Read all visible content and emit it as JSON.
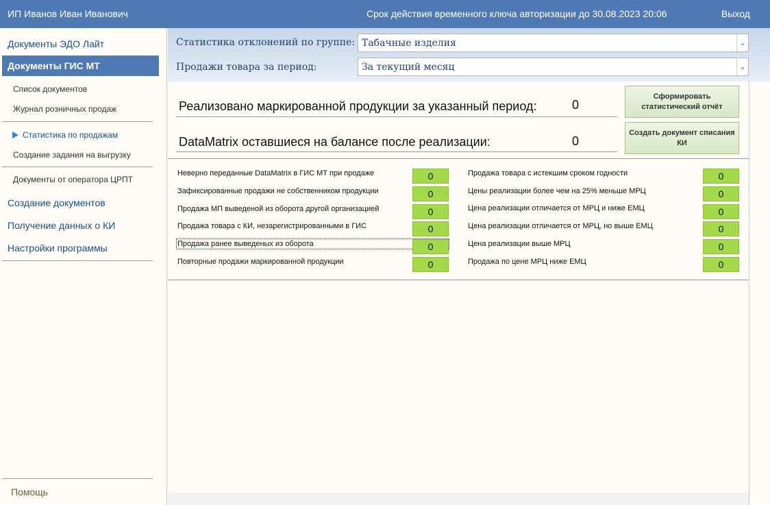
{
  "header": {
    "user": "ИП Иванов Иван Иванович",
    "key_validity": "Срок действия временного ключа авторизации до 30.08.2023 20:06",
    "logout": "Выход"
  },
  "sidebar": {
    "edo_lite": "Документы ЭДО Лайт",
    "gis_mt": "Документы ГИС МТ",
    "doc_list": "Список документов",
    "retail_journal": "Журнал розничных продаж",
    "sales_stats": "Статистика по продажам",
    "export_task": "Создание задания на выгрузку",
    "crpt_docs": "Документы от оператора ЦРПТ",
    "create_docs": "Создание документов",
    "ki_data": "Получение данных о КИ",
    "settings": "Настройки программы",
    "help": "Помощь"
  },
  "filter": {
    "group_label": "Статистика отклонений по группе:",
    "group_value": "Табачные изделия",
    "period_label": "Продажи товара за период:",
    "period_value": "За текущий месяц"
  },
  "summary": {
    "sold_label": "Реализовано маркированной продукции за указанный период:",
    "sold_value": "0",
    "balance_label": "DataMatrix оставшиеся на балансе после реализации:",
    "balance_value": "0",
    "report_button": "Сформировать статистический отчёт",
    "writeoff_button": "Создать документ списания КИ"
  },
  "left_stats": [
    {
      "label": "Неверно переданные DataMatrix в ГИС МТ при продаже",
      "value": "0"
    },
    {
      "label": "Зафиксированные продажи не собственником продукции",
      "value": "0"
    },
    {
      "label": "Продажа МП выведеной из оборота другой организацией",
      "value": "0"
    },
    {
      "label": "Продажа товара с КИ, незарегистрированными в ГИС",
      "value": "0"
    },
    {
      "label": "Продажа ранее выведеных из оборота",
      "value": "0"
    },
    {
      "label": "Повторные продажи маркированной продукции",
      "value": "0"
    }
  ],
  "right_stats": [
    {
      "label": "Продажа товара с истекшим сроком годности",
      "value": "0"
    },
    {
      "label": "Цены реализации более чем на 25% меньше МРЦ",
      "value": "0"
    },
    {
      "label": "Цена реализации отличается от МРЦ и ниже ЕМЦ",
      "value": "0"
    },
    {
      "label": "Цена реализации отличается от МРЦ, но выше ЕМЦ",
      "value": "0"
    },
    {
      "label": "Цена реализации выше МРЦ",
      "value": "0"
    },
    {
      "label": "Продажа по цене МРЦ ниже ЕМЦ",
      "value": "0"
    }
  ]
}
